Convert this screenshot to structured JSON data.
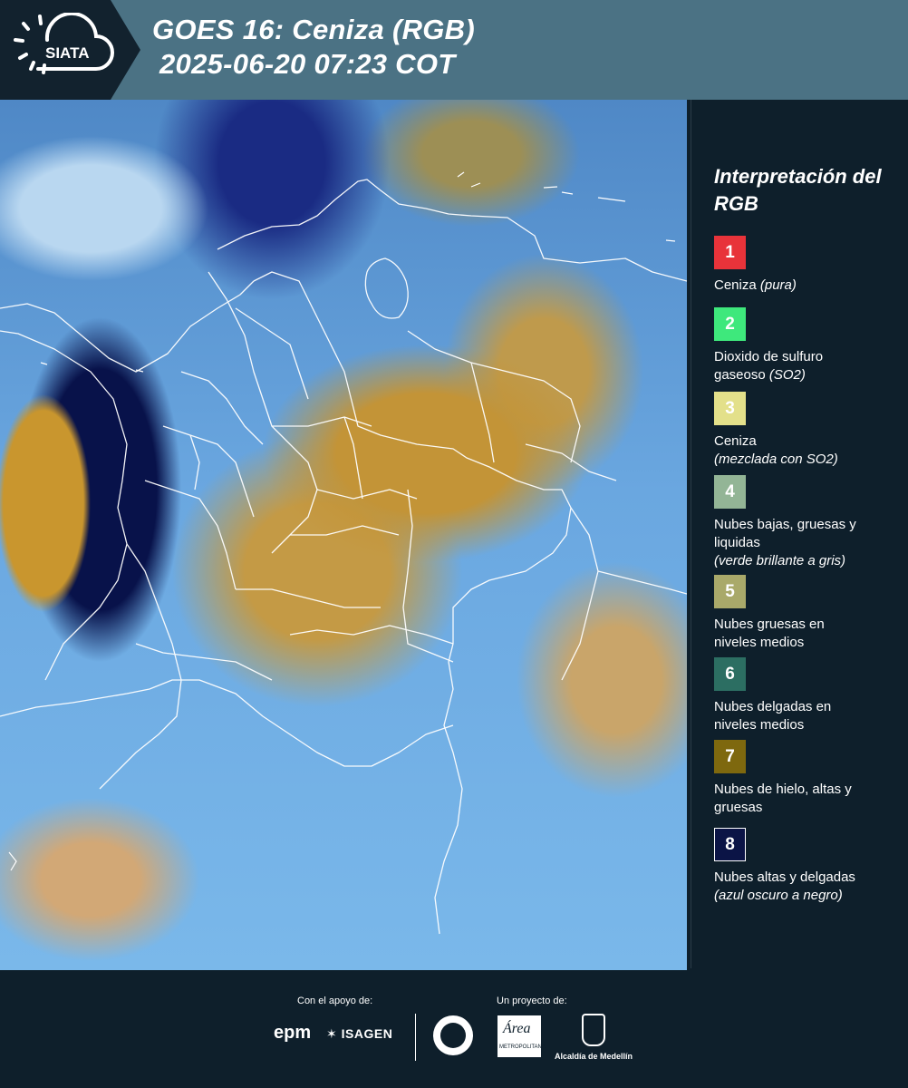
{
  "header": {
    "brand": "SIATA",
    "title_line1": "GOES 16: Ceniza (RGB)",
    "title_line2": "2025-06-20 07:23 COT"
  },
  "map": {
    "description_icon": "satellite-map",
    "colors": {
      "ocean": "#6aa7e0",
      "ash_cloud": "#c9962e",
      "high_cloud": "#08124a",
      "border": "#ffffff"
    }
  },
  "legend": {
    "title": "Interpretación del RGB",
    "items": [
      {
        "num": "1",
        "color": "#e8333a",
        "text": "Ceniza",
        "note": "(pura)"
      },
      {
        "num": "2",
        "color": "#3ee87c",
        "text": "Dioxido de sulfuro gaseoso",
        "note": "(SO2)"
      },
      {
        "num": "3",
        "color": "#e3e08a",
        "text": "Ceniza",
        "note": "(mezclada con SO2)"
      },
      {
        "num": "4",
        "color": "#93b596",
        "text": "Nubes bajas, gruesas y liquidas",
        "note": "(verde brillante a gris)"
      },
      {
        "num": "5",
        "color": "#a9a96a",
        "text": "Nubes gruesas en niveles medios",
        "note": ""
      },
      {
        "num": "6",
        "color": "#2c6e62",
        "text": "Nubes delgadas en niveles medios",
        "note": ""
      },
      {
        "num": "7",
        "color": "#7e680e",
        "text": "Nubes de hielo, altas y gruesas",
        "note": ""
      },
      {
        "num": "8",
        "color": "#0b1446",
        "text": "Nubes altas y delgadas",
        "note": "(azul oscuro a negro)"
      }
    ]
  },
  "footer": {
    "support_label": "Con el apoyo de:",
    "project_label": "Un proyecto de:",
    "epm": "epm",
    "isagen": "ISAGEN",
    "area_word": "Área",
    "area_sub": "METROPOLITANA",
    "alcaldia": "Alcaldía de Medellín"
  }
}
